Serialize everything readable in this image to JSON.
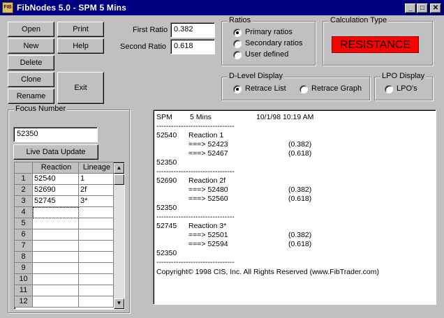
{
  "window": {
    "title": "FibNodes 5.0 - SPM  5 Mins",
    "icon_label": "FIB",
    "controls": {
      "minimize": "_",
      "maximize": "□",
      "close": "✕"
    }
  },
  "buttons": {
    "open": "Open",
    "print": "Print",
    "new": "New",
    "help": "Help",
    "delete": "Delete",
    "clone": "Clone",
    "exit": "Exit",
    "rename": "Rename"
  },
  "ratios": {
    "first_label": "First Ratio",
    "first_value": "0.382",
    "second_label": "Second Ratio",
    "second_value": "0.618"
  },
  "ratios_group": {
    "title": "Ratios",
    "options": [
      "Primary ratios",
      "Secondary ratios",
      "User defined"
    ],
    "selected": "Primary ratios"
  },
  "calc_type": {
    "title": "Calculation Type",
    "value": "RESISTANCE",
    "color": "#ff0000"
  },
  "dlevel": {
    "title": "D-Level Display",
    "options": [
      "Retrace List",
      "Retrace Graph"
    ],
    "selected": "Retrace List"
  },
  "lpo": {
    "title": "LPO Display",
    "option": "LPO's"
  },
  "focus": {
    "title": "Focus Number",
    "value": "52350",
    "live_button": "Live Data Update"
  },
  "grid": {
    "columns": [
      "Reaction",
      "Lineage"
    ],
    "rows": [
      {
        "n": "1",
        "reaction": "52540",
        "lineage": "1"
      },
      {
        "n": "2",
        "reaction": "52690",
        "lineage": "2f"
      },
      {
        "n": "3",
        "reaction": "52745",
        "lineage": "3*"
      },
      {
        "n": "4",
        "reaction": "",
        "lineage": ""
      },
      {
        "n": "5",
        "reaction": "",
        "lineage": ""
      },
      {
        "n": "6",
        "reaction": "",
        "lineage": ""
      },
      {
        "n": "7",
        "reaction": "",
        "lineage": ""
      },
      {
        "n": "8",
        "reaction": "",
        "lineage": ""
      },
      {
        "n": "9",
        "reaction": "",
        "lineage": ""
      },
      {
        "n": "10",
        "reaction": "",
        "lineage": ""
      },
      {
        "n": "11",
        "reaction": "",
        "lineage": ""
      },
      {
        "n": "12",
        "reaction": "",
        "lineage": ""
      }
    ]
  },
  "output": {
    "header": {
      "symbol": "SPM",
      "interval": "5 Mins",
      "datetime": "10/1/98 10:19 AM"
    },
    "separator": "--------------------------------",
    "blocks": [
      {
        "price": "52540",
        "label": "Reaction 1",
        "lines": [
          {
            "arrow": "===> 52423",
            "ratio": "(0.382)"
          },
          {
            "arrow": "===> 52467",
            "ratio": "(0.618)"
          }
        ],
        "focus": "52350"
      },
      {
        "price": "52690",
        "label": "Reaction 2f",
        "lines": [
          {
            "arrow": "===> 52480",
            "ratio": "(0.382)"
          },
          {
            "arrow": "===> 52560",
            "ratio": "(0.618)"
          }
        ],
        "focus": "52350"
      },
      {
        "price": "52745",
        "label": "Reaction 3*",
        "lines": [
          {
            "arrow": "===> 52501",
            "ratio": "(0.382)"
          },
          {
            "arrow": "===> 52594",
            "ratio": "(0.618)"
          }
        ],
        "focus": "52350"
      }
    ],
    "copyright": "Copyright© 1998 CIS, Inc. All Rights Reserved (www.FibTrader.com)"
  }
}
